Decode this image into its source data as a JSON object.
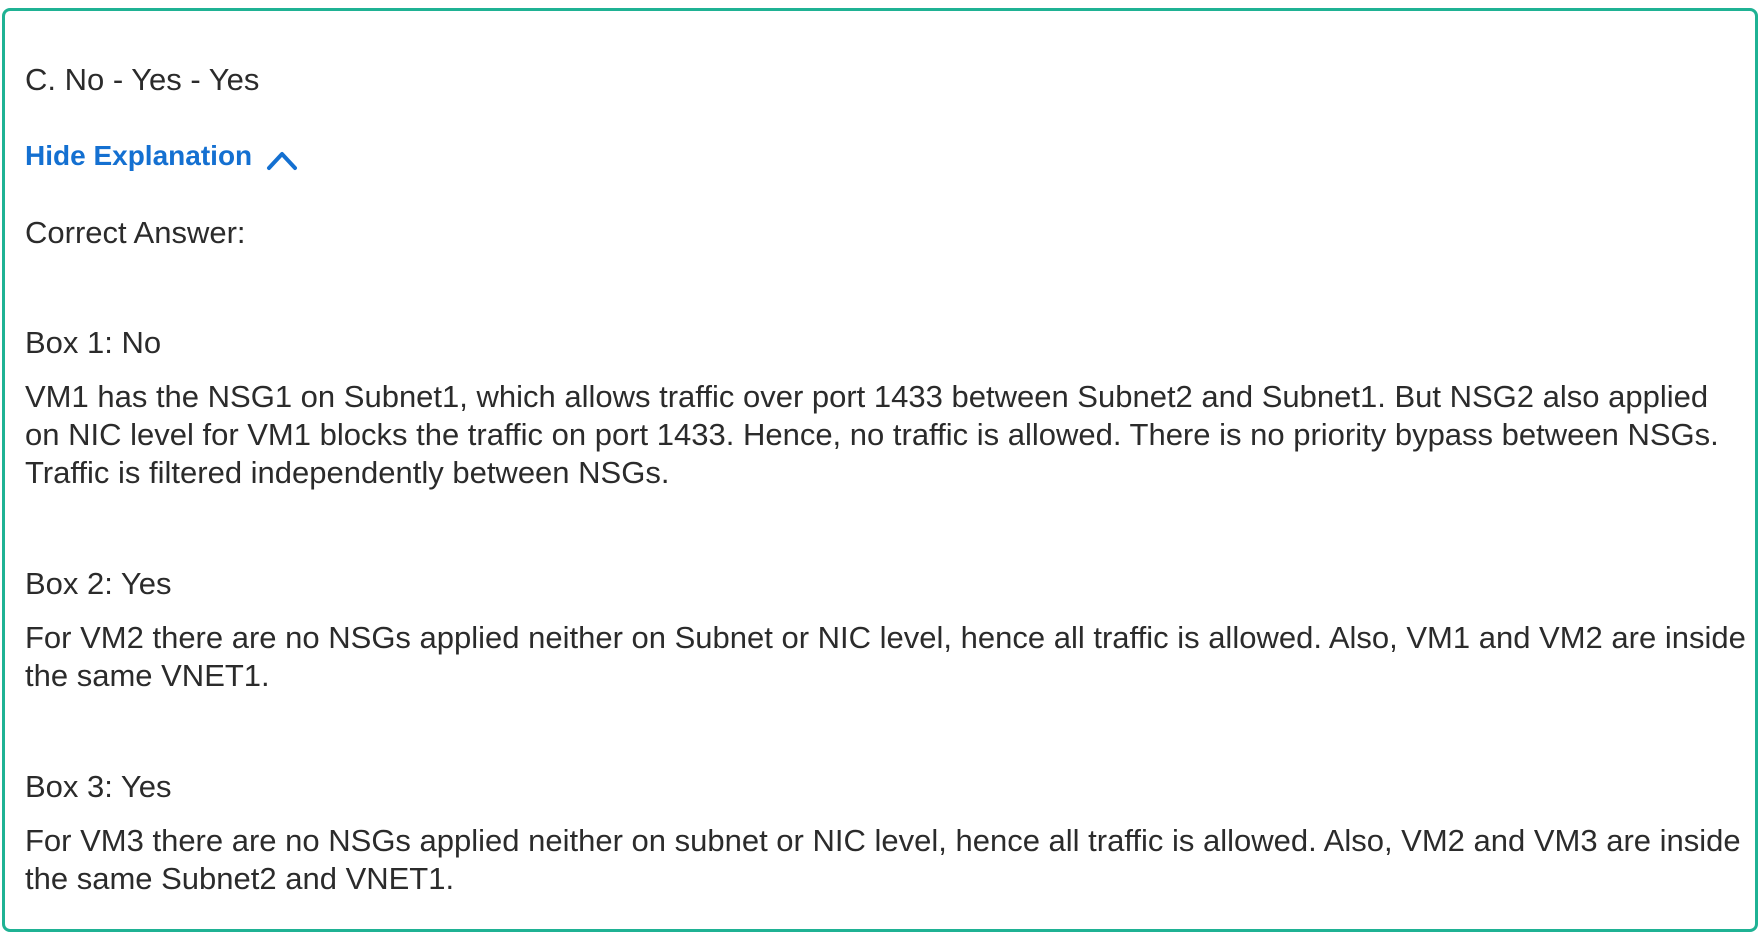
{
  "answer_option": "C. No - Yes - Yes",
  "explanation_toggle": {
    "label": "Hide Explanation",
    "icon": "chevron-up-icon",
    "color": "#1470d1"
  },
  "correct_answer_label": "Correct Answer:",
  "boxes": [
    {
      "title": "Box 1: No",
      "text": "VM1 has the NSG1 on Subnet1, which allows traffic over port 1433 between Subnet2 and Subnet1. But NSG2 also applied on NIC level for VM1 blocks the traffic on port 1433. Hence, no traffic is allowed. There is no priority bypass between NSGs. Traffic is filtered independently between NSGs."
    },
    {
      "title": "Box 2: Yes",
      "text": "For VM2 there are no NSGs applied neither on Subnet or NIC level, hence all traffic is allowed. Also, VM1 and VM2 are inside the same VNET1."
    },
    {
      "title": "Box 3: Yes",
      "text": "For VM3 there are no NSGs applied neither on subnet or NIC level, hence all traffic is allowed. Also, VM2 and VM3 are inside the same Subnet2 and VNET1."
    }
  ],
  "colors": {
    "card_border": "#1fb294",
    "text": "#2b2b2b",
    "link": "#1470d1"
  }
}
